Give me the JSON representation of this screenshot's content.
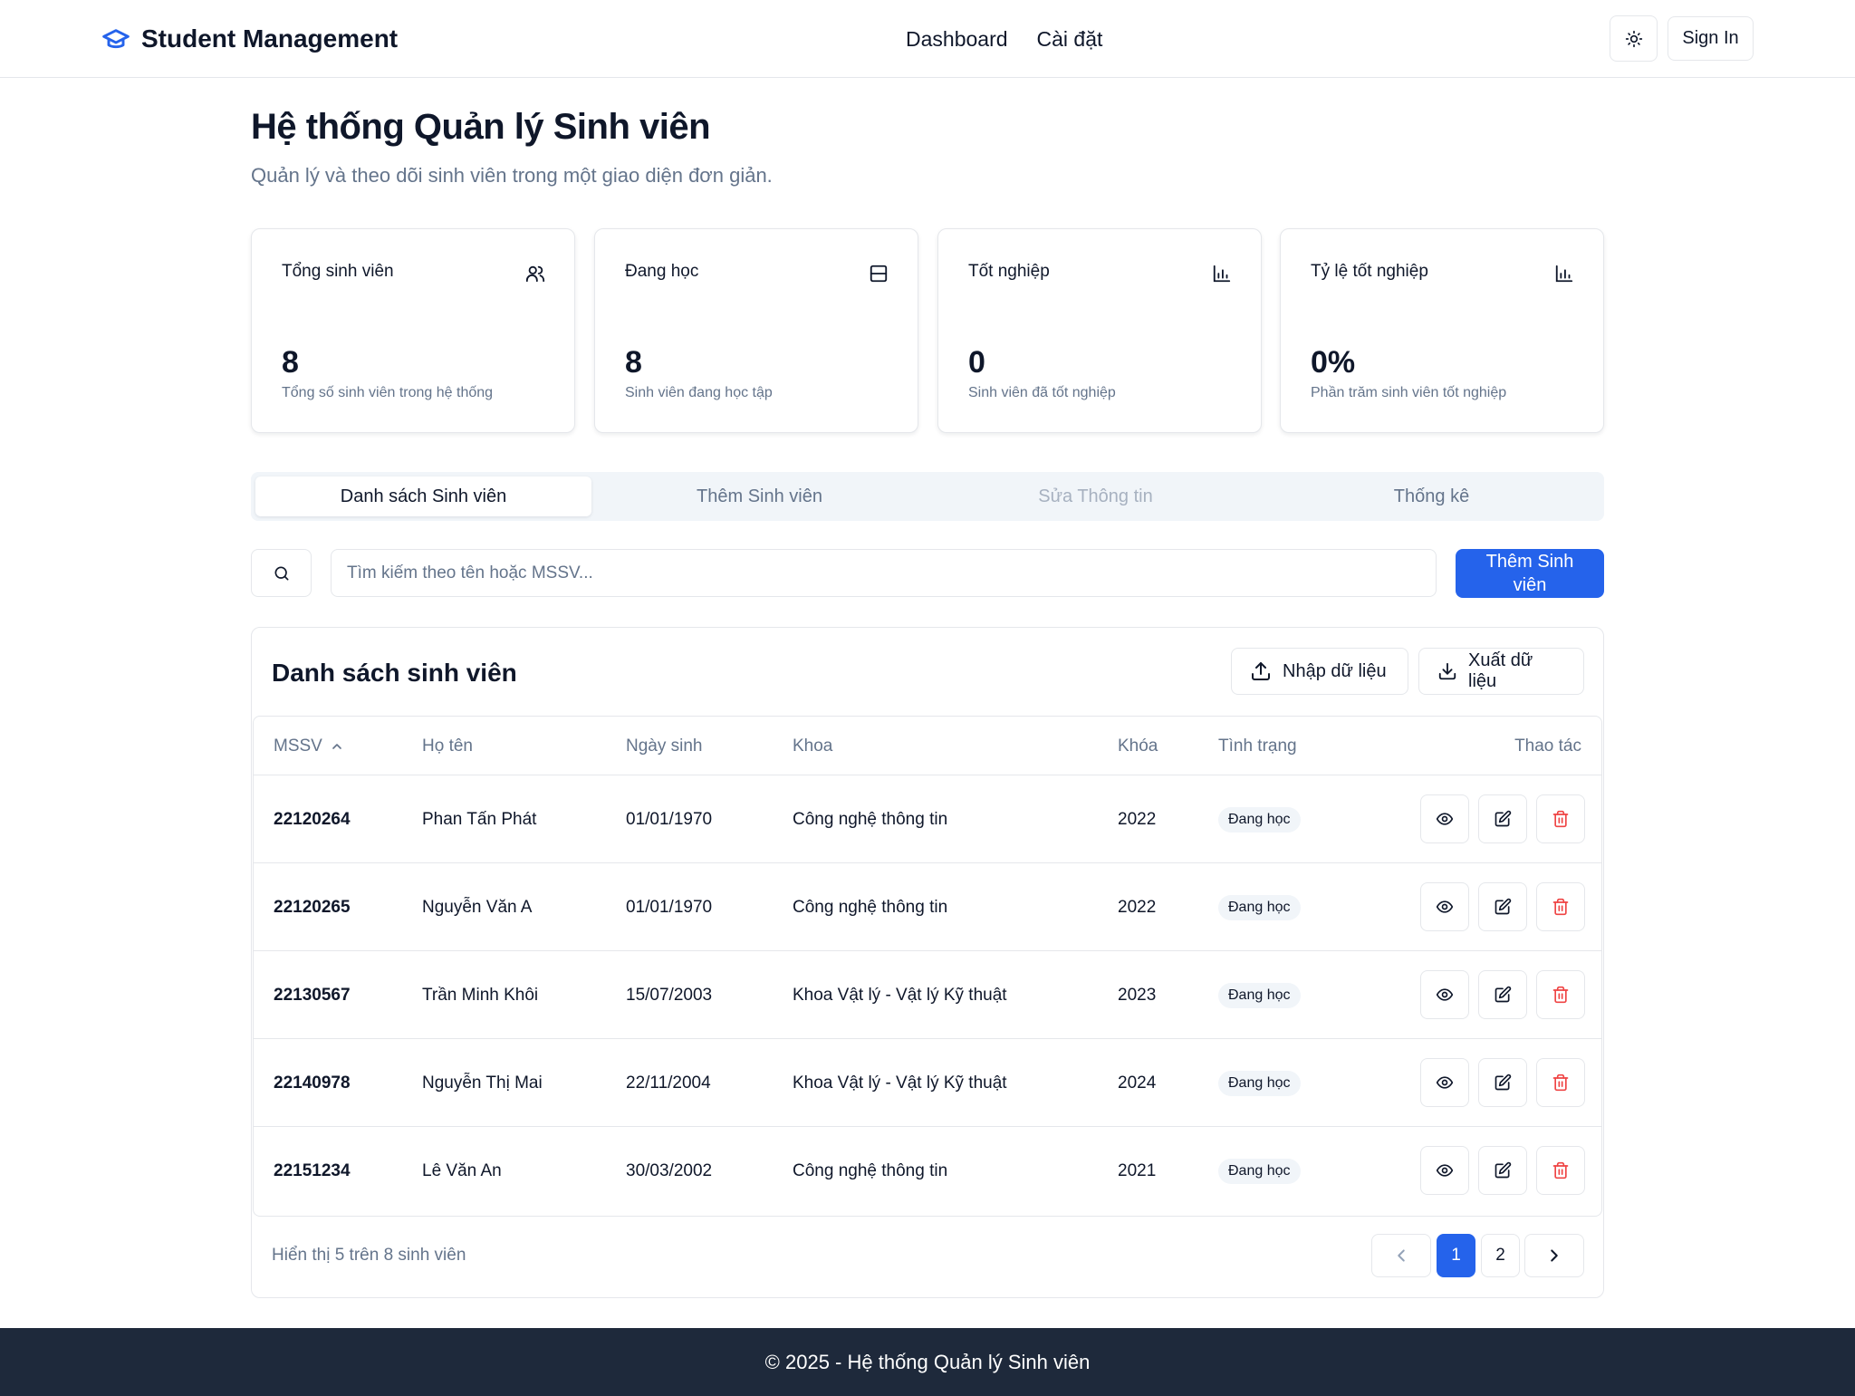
{
  "header": {
    "brand": "Student Management",
    "nav": [
      "Dashboard",
      "Cài đặt"
    ],
    "sign_in": "Sign In"
  },
  "page": {
    "title": "Hệ thống Quản lý Sinh viên",
    "subtitle": "Quản lý và theo dõi sinh viên trong một giao diện đơn giản."
  },
  "stats": [
    {
      "title": "Tổng sinh viên",
      "value": "8",
      "description": "Tổng số sinh viên trong hệ thống",
      "icon": "users-icon"
    },
    {
      "title": "Đang học",
      "value": "8",
      "description": "Sinh viên đang học tập",
      "icon": "layout-icon"
    },
    {
      "title": "Tốt nghiệp",
      "value": "0",
      "description": "Sinh viên đã tốt nghiệp",
      "icon": "bar-chart-icon"
    },
    {
      "title": "Tỷ lệ tốt nghiệp",
      "value": "0%",
      "description": "Phần trăm sinh viên tốt nghiệp",
      "icon": "bar-chart-icon"
    }
  ],
  "tabs": [
    {
      "label": "Danh sách Sinh viên",
      "state": "active"
    },
    {
      "label": "Thêm Sinh viên",
      "state": "normal"
    },
    {
      "label": "Sửa Thông tin",
      "state": "disabled"
    },
    {
      "label": "Thống kê",
      "state": "normal"
    }
  ],
  "search": {
    "placeholder": "Tìm kiếm theo tên hoặc MSSV...",
    "value": "",
    "add_button": "Thêm Sinh viên"
  },
  "table": {
    "title": "Danh sách sinh viên",
    "import_label": "Nhập dữ liệu",
    "export_label": "Xuất dữ liệu",
    "columns": [
      "MSSV",
      "Họ tên",
      "Ngày sinh",
      "Khoa",
      "Khóa",
      "Tình trạng",
      "Thao tác"
    ],
    "rows": [
      {
        "mssv": "22120264",
        "name": "Phan Tấn Phát",
        "dob": "01/01/1970",
        "faculty": "Công nghệ thông tin",
        "year": "2022",
        "status": "Đang học"
      },
      {
        "mssv": "22120265",
        "name": "Nguyễn Văn A",
        "dob": "01/01/1970",
        "faculty": "Công nghệ thông tin",
        "year": "2022",
        "status": "Đang học"
      },
      {
        "mssv": "22130567",
        "name": "Trần Minh Khôi",
        "dob": "15/07/2003",
        "faculty": "Khoa Vật lý - Vật lý Kỹ thuật",
        "year": "2023",
        "status": "Đang học"
      },
      {
        "mssv": "22140978",
        "name": "Nguyễn Thị Mai",
        "dob": "22/11/2004",
        "faculty": "Khoa Vật lý - Vật lý Kỹ thuật",
        "year": "2024",
        "status": "Đang học"
      },
      {
        "mssv": "22151234",
        "name": "Lê Văn An",
        "dob": "30/03/2002",
        "faculty": "Công nghệ thông tin",
        "year": "2021",
        "status": "Đang học"
      }
    ],
    "summary": "Hiển thị 5 trên 8 sinh viên",
    "pages": [
      "1",
      "2"
    ],
    "current_page": "1"
  },
  "footer": {
    "text": "© 2025 - Hệ thống Quản lý Sinh viên"
  },
  "colors": {
    "primary": "#2563eb",
    "footer_bg": "#1e293b",
    "danger": "#ef4444",
    "muted": "#64748b"
  }
}
